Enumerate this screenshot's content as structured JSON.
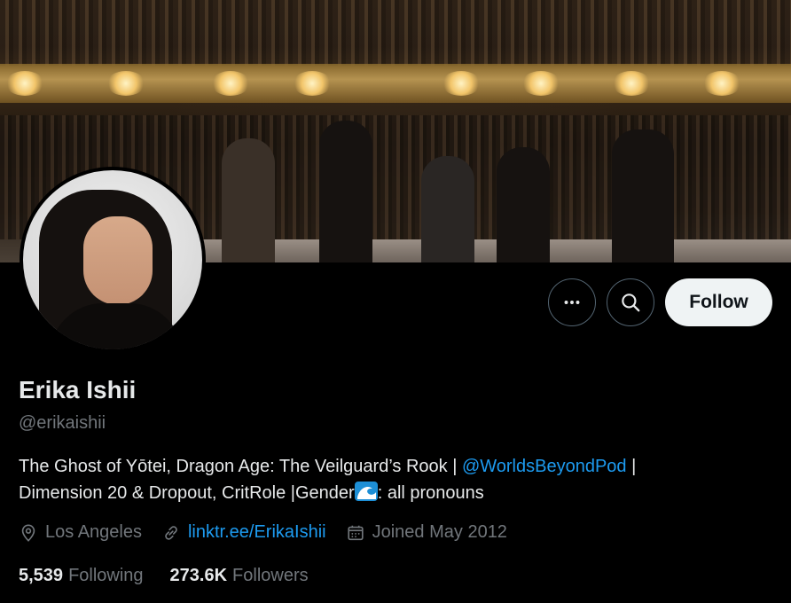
{
  "profile": {
    "display_name": "Erika Ishii",
    "handle": "@erikaishii",
    "bio": {
      "part1": "The Ghost of Yōtei, Dragon Age: The Veilguard’s Rook | ",
      "mention": "@WorldsBeyondPod",
      "part2": " |",
      "line2_start": "Dimension 20 & Dropout, CritRole |Gender",
      "line2_end": ": all pronouns",
      "emoji": "wave-emoji"
    },
    "location": "Los Angeles",
    "website": "linktr.ee/ErikaIshii",
    "joined": "Joined May 2012"
  },
  "actions": {
    "more_icon": "more-dots-icon",
    "search_icon": "search-icon",
    "follow_label": "Follow"
  },
  "stats": {
    "following_count": "5,539",
    "following_label": "Following",
    "followers_count": "273.6K",
    "followers_label": "Followers"
  },
  "colors": {
    "background": "#000000",
    "link": "#1d9bf0",
    "muted": "#71767b",
    "text": "#e7e9ea",
    "follow_button_bg": "#eff3f4"
  }
}
